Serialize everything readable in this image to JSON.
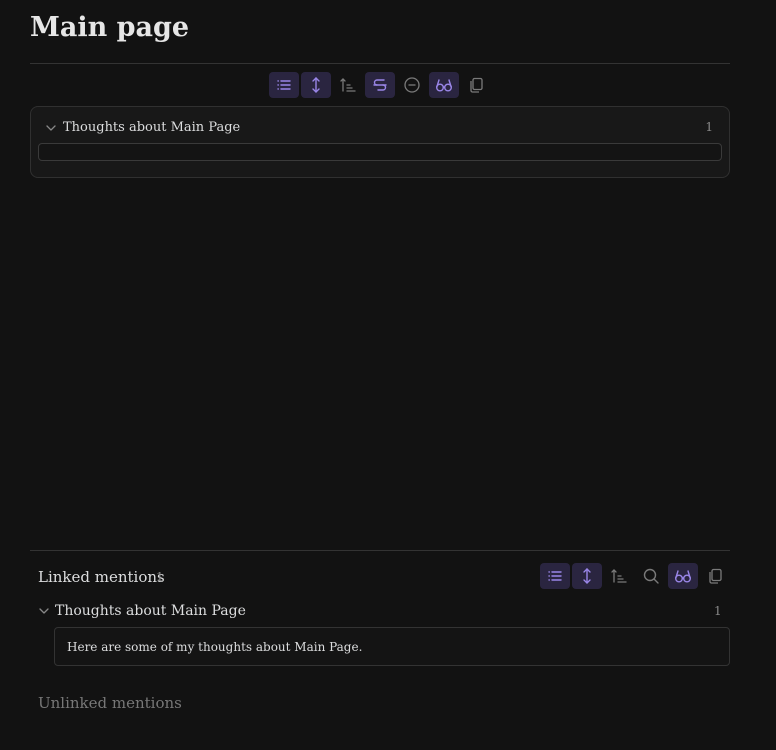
{
  "page": {
    "title": "Main page"
  },
  "embedded_query": {
    "toolbar": [
      {
        "icon": "list-icon",
        "active": true
      },
      {
        "icon": "expand-vertical-icon",
        "active": true
      },
      {
        "icon": "sort-ascending-icon",
        "active": false
      },
      {
        "icon": "strikethrough-icon",
        "active": true
      },
      {
        "icon": "minus-circle-icon",
        "active": false
      },
      {
        "icon": "glasses-icon",
        "active": true
      },
      {
        "icon": "copy-icon",
        "active": false
      }
    ],
    "group_title": "Thoughts about Main Page",
    "group_count": "1"
  },
  "linked_mentions": {
    "title": "Linked mentions",
    "count": "1",
    "toolbar": [
      {
        "icon": "list-icon",
        "active": true
      },
      {
        "icon": "expand-vertical-icon",
        "active": true
      },
      {
        "icon": "sort-ascending-icon",
        "active": false
      },
      {
        "icon": "search-icon",
        "active": false
      },
      {
        "icon": "glasses-icon",
        "active": true
      },
      {
        "icon": "copy-icon",
        "active": false
      }
    ],
    "group_title": "Thoughts about Main Page",
    "group_count": "1",
    "mention_text": "Here are some of my thoughts about Main Page."
  },
  "unlinked_mentions": {
    "title": "Unlinked mentions"
  },
  "colors": {
    "background": "#121212",
    "accent": "#9a86e8",
    "accent_bg": "#2a2540"
  }
}
